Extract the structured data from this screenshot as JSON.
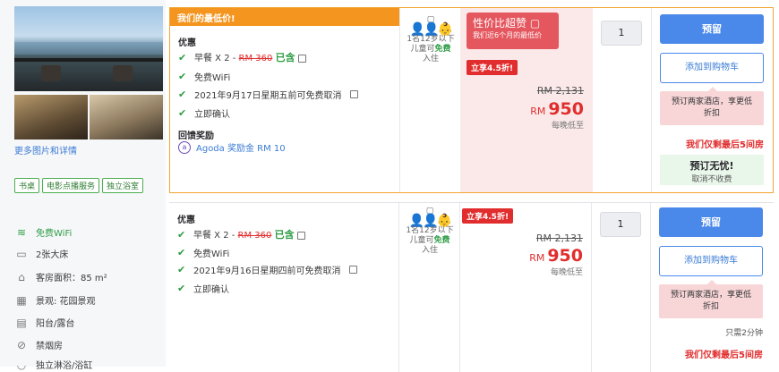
{
  "left": {
    "more_link": "更多图片和详情",
    "tags": [
      "书桌",
      "电影点播服务",
      "独立浴室"
    ],
    "amenities": [
      {
        "icon": "wifi-icon",
        "glyph": "📶",
        "label": "免费WiFi",
        "green": true
      },
      {
        "icon": "bed-icon",
        "glyph": "🛏",
        "label": "2张大床",
        "green": false
      },
      {
        "icon": "area-icon",
        "glyph": "⌂",
        "label": "客房面积：85 m²",
        "green": false
      },
      {
        "icon": "view-icon",
        "glyph": "▦",
        "label": "景观: 花园景观",
        "green": false
      },
      {
        "icon": "balcony-icon",
        "glyph": "▤",
        "label": "阳台/露台",
        "green": false
      },
      {
        "icon": "no-smoking-icon",
        "glyph": "⊘",
        "label": "禁烟房",
        "green": false
      },
      {
        "icon": "bath-icon",
        "glyph": "◡",
        "label": "独立淋浴/浴缸",
        "green": false
      }
    ]
  },
  "row1": {
    "banner": "我们的最低价!",
    "offers_title": "优惠",
    "breakfast_prefix": "早餐 X 2 - ",
    "breakfast_old": "RM 360",
    "breakfast_included": "已含",
    "wifi": "免费WiFi",
    "cancel": "2021年9月17日星期五前可免费取消",
    "confirm": "立即确认",
    "reward_title": "回馈奖励",
    "reward": "Agoda 奖励金 RM 10",
    "occupancy": [
      "1名12岁以下",
      "儿童可",
      "免费",
      "入住"
    ],
    "value_title": "性价比超赞",
    "value_sub": "我们近6个月的最低价",
    "discount": "立享4.5折!",
    "original_price": "RM 2,131",
    "currency": "RM",
    "price": "950",
    "per_night": "每晚低至",
    "qty": "1",
    "book": "预留",
    "cart": "添加到购物车",
    "tip": [
      "预订两家酒店，享更低",
      "折扣"
    ],
    "last_rooms": "我们仅剩最后5间房",
    "worry_title": "预订无忧!",
    "worry_sub": "取消不收费"
  },
  "row2": {
    "offers_title": "优惠",
    "breakfast_prefix": "早餐 X 2 - ",
    "breakfast_old": "RM 360",
    "breakfast_included": "已含",
    "wifi": "免费WiFi",
    "cancel": "2021年9月16日星期四前可免费取消",
    "confirm": "立即确认",
    "occupancy": [
      "1名12岁以下",
      "儿童可",
      "免费",
      "入住"
    ],
    "discount": "立享4.5折!",
    "original_price": "RM 2,131",
    "currency": "RM",
    "price": "950",
    "per_night": "每晚低至",
    "qty": "1",
    "book": "预留",
    "cart": "添加到购物车",
    "tip": [
      "预订两家酒店，享更低",
      "折扣"
    ],
    "minutes": "只需2分钟",
    "last_rooms": "我们仅剩最后5间房"
  }
}
